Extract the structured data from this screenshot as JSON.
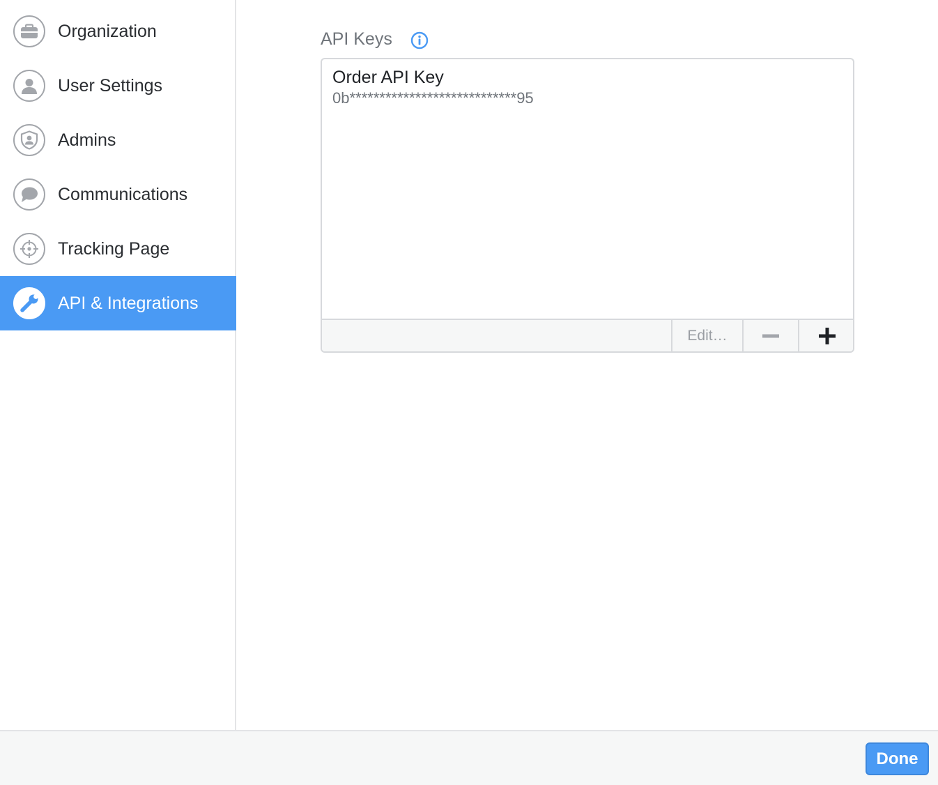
{
  "sidebar": {
    "items": [
      {
        "label": "Organization",
        "icon": "briefcase-icon",
        "active": false
      },
      {
        "label": "User Settings",
        "icon": "user-icon",
        "active": false
      },
      {
        "label": "Admins",
        "icon": "shield-user-icon",
        "active": false
      },
      {
        "label": "Communications",
        "icon": "chat-bubble-icon",
        "active": false
      },
      {
        "label": "Tracking Page",
        "icon": "crosshair-icon",
        "active": false
      },
      {
        "label": "API & Integrations",
        "icon": "wrench-icon",
        "active": true
      }
    ]
  },
  "main": {
    "section_title": "API Keys",
    "keys": [
      {
        "name": "Order API Key",
        "masked_value": "0b****************************95"
      }
    ],
    "toolbar": {
      "edit_label": "Edit…"
    }
  },
  "footer": {
    "done_label": "Done"
  },
  "colors": {
    "accent": "#4a9af4",
    "sidebar_icon": "#a3a6ab",
    "text_primary": "#2a2d31",
    "text_secondary": "#6f747a"
  }
}
